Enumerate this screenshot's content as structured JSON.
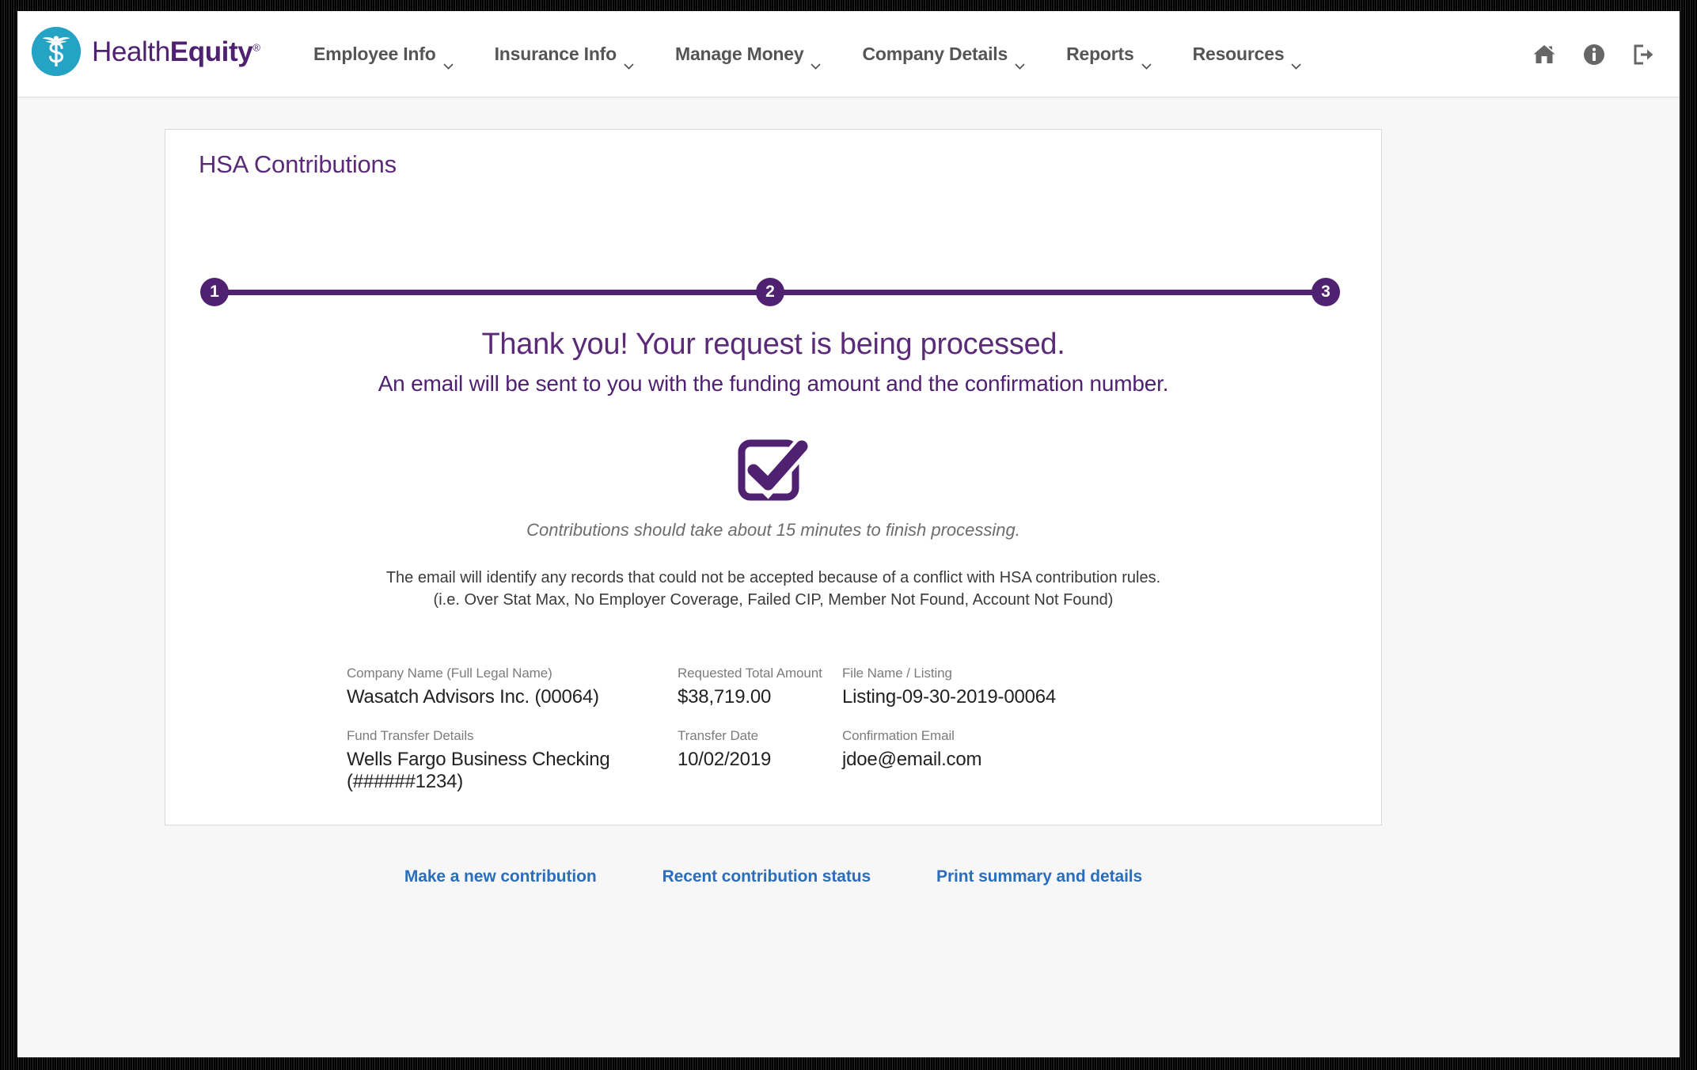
{
  "brand": {
    "logo_text_part1": "Health",
    "logo_text_part2": "Equity",
    "logo_registered": "®",
    "logo_icon": "caduceus-dollar-icon",
    "purple": "#4f2170",
    "teal": "#25a3c4",
    "link_blue": "#2a6ebb"
  },
  "header": {
    "nav": [
      {
        "label": "Employee Info",
        "icon": "chevron-down-icon"
      },
      {
        "label": "Insurance Info",
        "icon": "chevron-down-icon"
      },
      {
        "label": "Manage Money",
        "icon": "chevron-down-icon"
      },
      {
        "label": "Company Details",
        "icon": "chevron-down-icon"
      },
      {
        "label": "Reports",
        "icon": "chevron-down-icon"
      },
      {
        "label": "Resources",
        "icon": "chevron-down-icon"
      }
    ],
    "icons": [
      {
        "name": "home-icon"
      },
      {
        "name": "info-circle-icon"
      },
      {
        "name": "sign-out-icon"
      }
    ]
  },
  "card": {
    "title": "HSA Contributions",
    "stepper": {
      "steps": [
        "1",
        "2",
        "3"
      ],
      "active_step": 3
    },
    "heading_primary": "Thank you! Your request is being processed.",
    "heading_secondary": "An email will be sent to you with the funding amount and the confirmation number.",
    "status_icon": "checkbox-checked-icon",
    "note_italic": "Contributions should take about 15 minutes to finish processing.",
    "note_line1": "The email will identify any records that could not be accepted because of a conflict with HSA contribution rules.",
    "note_line2": "(i.e. Over Stat Max, No Employer Coverage, Failed CIP, Member Not Found, Account Not Found)",
    "details": {
      "company_name_label": "Company Name (Full Legal Name)",
      "company_name_value": "Wasatch Advisors Inc.  (00064)",
      "requested_total_label": "Requested Total Amount",
      "requested_total_value": "$38,719.00",
      "file_name_label": "File Name / Listing",
      "file_name_value": "Listing-09-30-2019-00064",
      "fund_transfer_label": "Fund Transfer Details",
      "fund_transfer_value": "Wells Fargo Business Checking (######1234)",
      "transfer_date_label": "Transfer Date",
      "transfer_date_value": "10/02/2019",
      "confirmation_email_label": "Confirmation Email",
      "confirmation_email_value": "jdoe@email.com"
    },
    "links": [
      {
        "label": "Make a new contribution"
      },
      {
        "label": "Recent contribution status"
      },
      {
        "label": "Print summary and details"
      }
    ]
  }
}
